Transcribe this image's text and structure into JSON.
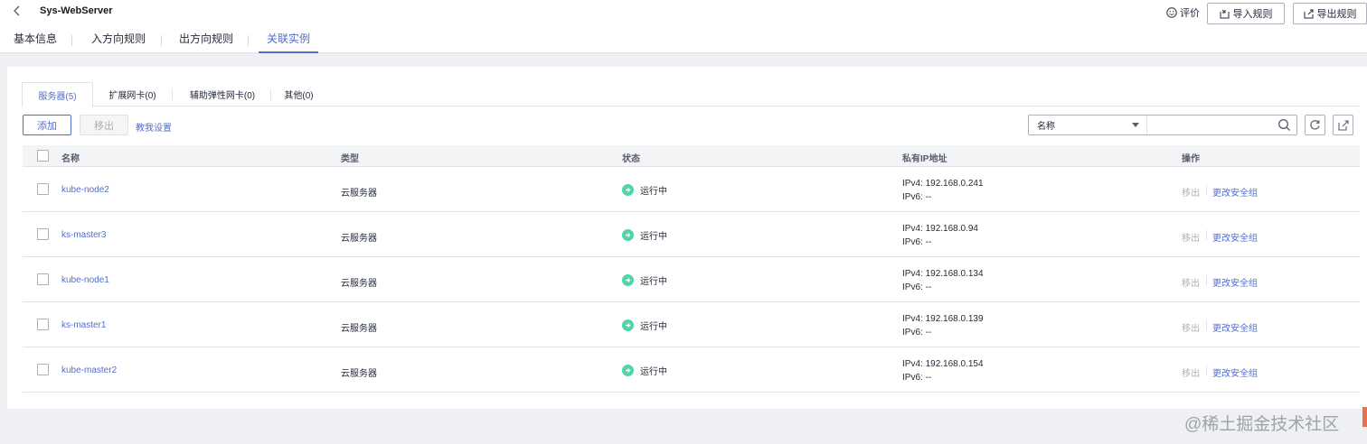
{
  "header": {
    "title": "Sys-WebServer",
    "rate_label": "评价",
    "import_label": "导入规则",
    "export_label": "导出规则"
  },
  "nav_tabs": [
    "基本信息",
    "入方向规则",
    "出方向规则",
    "关联实例"
  ],
  "sub_tabs": [
    "服务器(5)",
    "扩展网卡(0)",
    "辅助弹性网卡(0)",
    "其他(0)"
  ],
  "toolbar": {
    "add_label": "添加",
    "remove_label": "移出",
    "help_label": "教我设置",
    "search_field": "名称",
    "search_placeholder": ""
  },
  "table": {
    "headers": [
      "名称",
      "类型",
      "状态",
      "私有IP地址",
      "操作"
    ],
    "rows": [
      {
        "name": "kube-node2",
        "type": "云服务器",
        "status": "运行中",
        "ipv4": "IPv4: 192.168.0.241",
        "ipv6": "IPv6: --",
        "op_remove": "移出",
        "op_change": "更改安全组"
      },
      {
        "name": "ks-master3",
        "type": "云服务器",
        "status": "运行中",
        "ipv4": "IPv4: 192.168.0.94",
        "ipv6": "IPv6: --",
        "op_remove": "移出",
        "op_change": "更改安全组"
      },
      {
        "name": "kube-node1",
        "type": "云服务器",
        "status": "运行中",
        "ipv4": "IPv4: 192.168.0.134",
        "ipv6": "IPv6: --",
        "op_remove": "移出",
        "op_change": "更改安全组"
      },
      {
        "name": "ks-master1",
        "type": "云服务器",
        "status": "运行中",
        "ipv4": "IPv4: 192.168.0.139",
        "ipv6": "IPv6: --",
        "op_remove": "移出",
        "op_change": "更改安全组"
      },
      {
        "name": "kube-master2",
        "type": "云服务器",
        "status": "运行中",
        "ipv4": "IPv4: 192.168.0.154",
        "ipv6": "IPv6: --",
        "op_remove": "移出",
        "op_change": "更改安全组"
      }
    ]
  },
  "watermark": "@稀土掘金技术社区",
  "colors": {
    "accent": "#526ecc",
    "status_running": "#50d4ab",
    "background": "#eff0f3"
  }
}
